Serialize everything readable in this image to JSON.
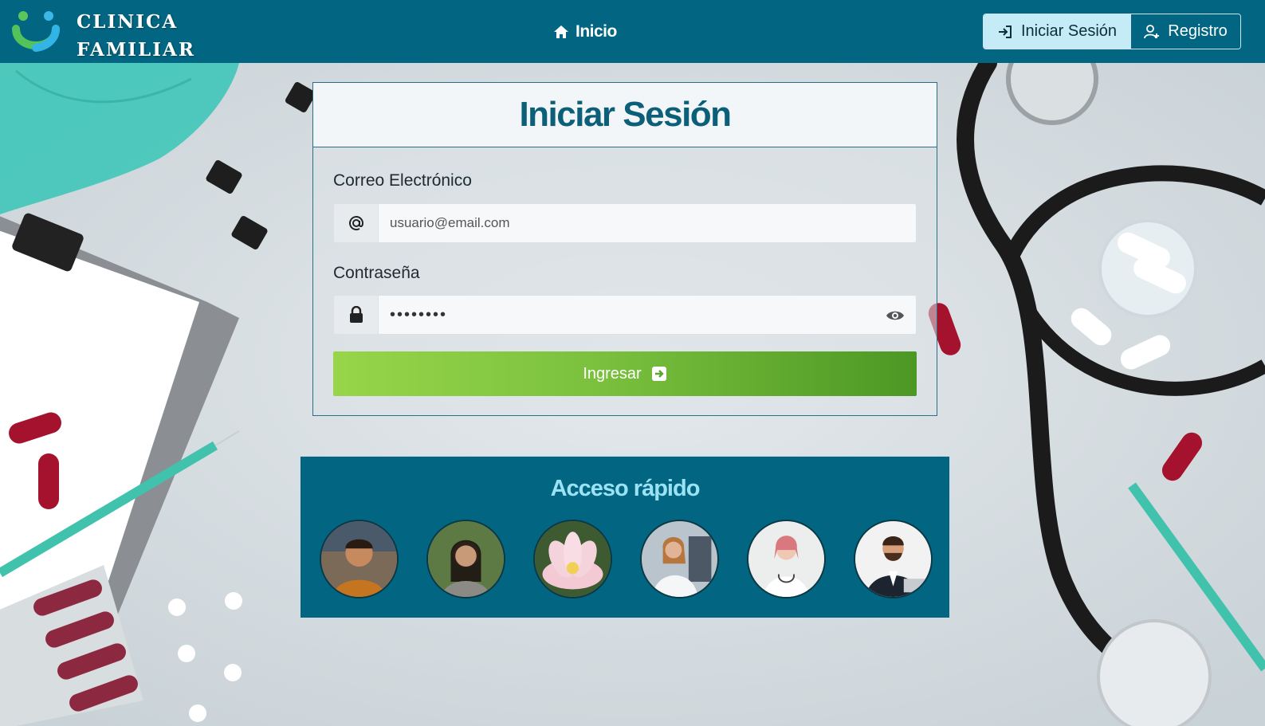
{
  "brand": {
    "line1": "CLINICA",
    "line2": "FAMILIAR",
    "logo_icon": "smile-logo-icon"
  },
  "nav": {
    "home_label": "Inicio",
    "home_icon": "home-icon",
    "login_label": "Iniciar Sesión",
    "login_icon": "login-icon",
    "register_label": "Registro",
    "register_icon": "user-plus-icon"
  },
  "login": {
    "title": "Iniciar Sesión",
    "email": {
      "label": "Correo Electrónico",
      "placeholder": "usuario@email.com",
      "icon": "at-icon"
    },
    "password": {
      "label": "Contraseña",
      "value": "••••••••",
      "icon": "lock-icon",
      "toggle_icon": "eye-icon"
    },
    "submit_label": "Ingresar",
    "submit_icon": "arrow-right-box-icon"
  },
  "quick_access": {
    "title": "Acceso rápido",
    "avatars": [
      {
        "name": "quick-user-1"
      },
      {
        "name": "quick-user-2"
      },
      {
        "name": "quick-user-3"
      },
      {
        "name": "quick-user-4"
      },
      {
        "name": "quick-user-5"
      },
      {
        "name": "quick-user-6"
      }
    ]
  },
  "colors": {
    "primary": "#026682",
    "accent_light": "#c5ecf6",
    "submit_start": "#97d54a",
    "submit_end": "#4c9824",
    "quick_title": "#9be3f4"
  }
}
